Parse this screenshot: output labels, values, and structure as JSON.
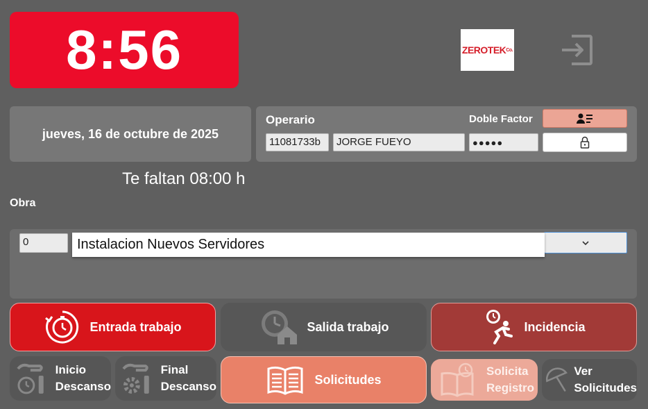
{
  "clock": {
    "time": "8:56"
  },
  "logo": {
    "brand_red": "ZERO",
    "brand_rest": "TEK",
    "suffix": "Co."
  },
  "date": {
    "text": "jueves, 16 de octubre de 2025"
  },
  "operator": {
    "label": "Operario",
    "code": "11081733b",
    "name": "JORGE FUEYO",
    "password_mask": "●●●●●",
    "double_factor_label": "Doble Factor"
  },
  "status": {
    "remaining": "Te faltan 08:00 h"
  },
  "obra": {
    "label": "Obra",
    "code": "0",
    "selected": "Instalacion Nuevos Servidores"
  },
  "actions": {
    "entrada": "Entrada trabajo",
    "salida": "Salida trabajo",
    "incidencia": "Incidencia",
    "inicio_l1": "Inicio",
    "inicio_l2": "Descanso",
    "final_l1": "Final",
    "final_l2": "Descanso",
    "solicitudes": "Solicitudes",
    "solicita_l1": "Solicita",
    "solicita_l2": "Registro",
    "ver_l1": "Ver",
    "ver_l2": "Solicitudes"
  },
  "icons": {
    "exit": "exit-icon",
    "contact": "contact-card-icon",
    "lock": "lock-icon",
    "chevron": "chevron-down-icon",
    "stopwatch": "stopwatch-icon",
    "clock-house": "clock-house-icon",
    "runner": "runner-clock-icon",
    "book": "book-icon"
  },
  "colors": {
    "background": "#5f5f5f",
    "clock_red": "#ec0c2a",
    "entrada": "#d8151b",
    "incidencia": "#a23a37",
    "solicitudes": "#e98168",
    "solicita": "#eca999"
  }
}
